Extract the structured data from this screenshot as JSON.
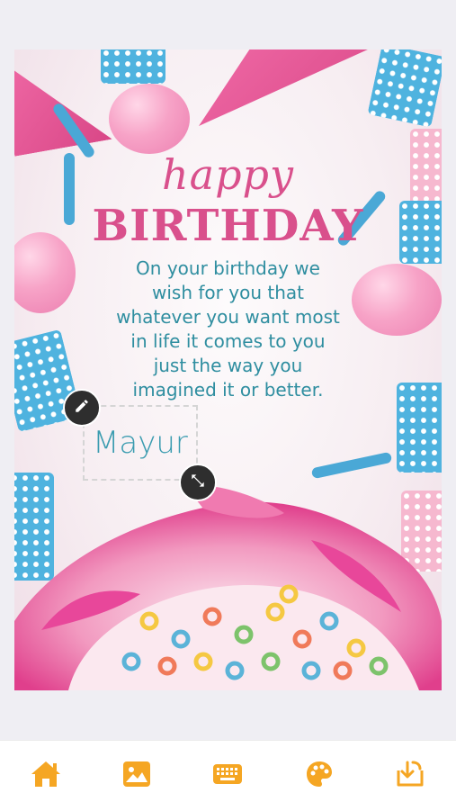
{
  "card": {
    "heading_script": "happy",
    "heading_main": "BIRTHDAY",
    "message_lines": [
      "On your birthday we",
      "wish for you that",
      "whatever you want most",
      "in life it comes to you",
      "just the way you",
      "imagined it or better."
    ],
    "name_text": "Mayur"
  },
  "handles": {
    "edit_icon": "pencil-icon",
    "resize_icon": "resize-arrows-icon"
  },
  "bottom_nav": {
    "accent_color": "#f5a623",
    "items": [
      {
        "icon": "home-icon"
      },
      {
        "icon": "image-icon"
      },
      {
        "icon": "keyboard-icon"
      },
      {
        "icon": "palette-icon"
      },
      {
        "icon": "download-icon"
      }
    ]
  }
}
